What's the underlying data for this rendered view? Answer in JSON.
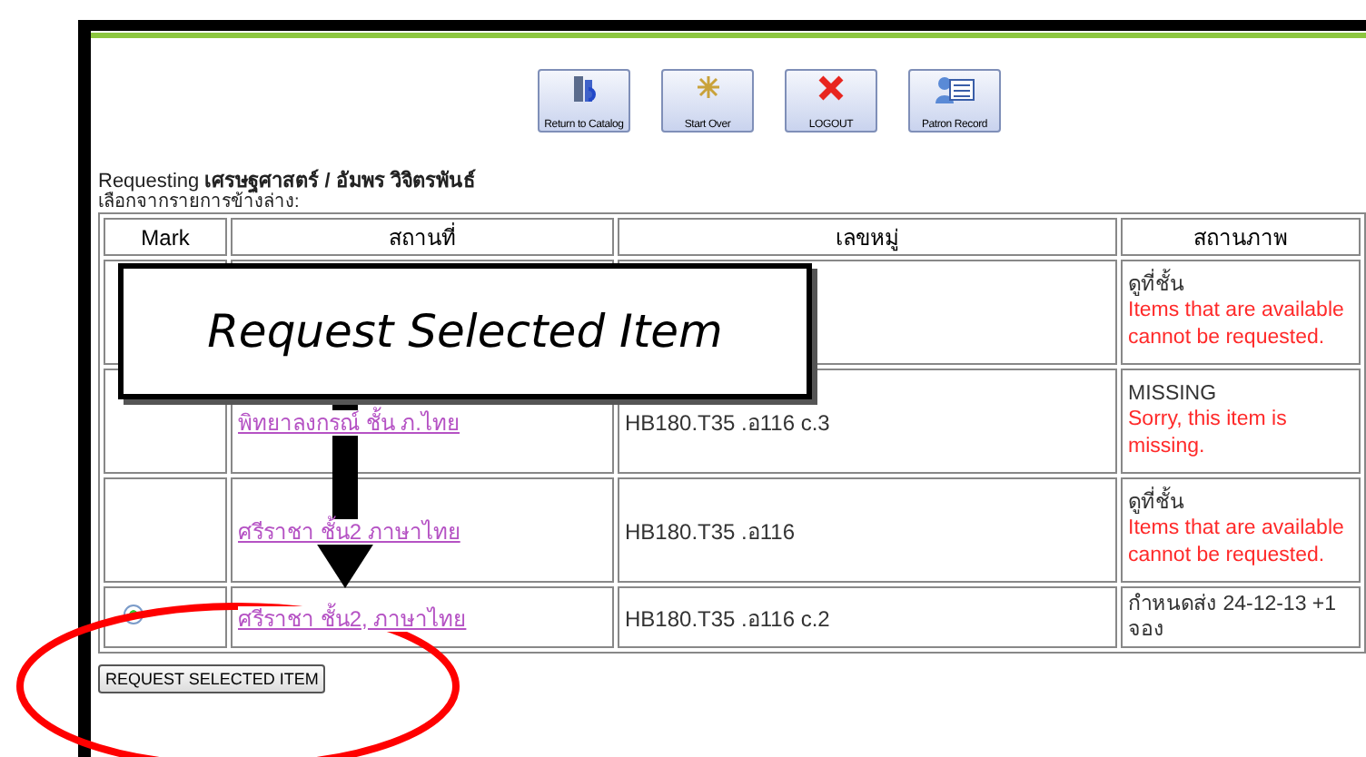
{
  "toolbar": [
    {
      "kind": "catalog",
      "label": "Return to Catalog"
    },
    {
      "kind": "restart",
      "label": "Start Over"
    },
    {
      "kind": "logout",
      "label": "LOGOUT"
    },
    {
      "kind": "patron",
      "label": "Patron Record"
    }
  ],
  "heading": "Requesting **เศรษฐศาสตร์ / อัมพร วิจิตรพันธ์**",
  "instruction": "เลือกจากรายการข้างล่าง:",
  "table": {
    "columns": [
      "Mark",
      "สถานที่",
      "เลขหมู่",
      "สถานภาพ"
    ],
    "rows": [
      {
        "kind": "plain",
        "selected": false,
        "status": "ดูที่ชั้น",
        "message": "Items that are available cannot be requested."
      },
      {
        "kind": "plain",
        "selected": false,
        "location": "พิทยาลงกรณ์ ชั้น ภ.ไทย",
        "call_number": "HB180.T35 .อ116 c.3",
        "status": "MISSING",
        "message": "Sorry, this item is missing."
      },
      {
        "kind": "plain",
        "selected": false,
        "location": "ศรีราชา ชั้น2 ภาษาไทย",
        "call_number": "HB180.T35 .อ116",
        "status": "ดูที่ชั้น",
        "message": "Items that are available cannot be requested."
      },
      {
        "kind": "radio",
        "selected": true,
        "location": "ศรีราชา ชั้น2, ภาษาไทย",
        "call_number": "HB180.T35 .อ116 c.2",
        "status": "กำหนดส่ง 24-12-13 +1 จอง"
      }
    ]
  },
  "submit": "REQUEST SELECTED ITEM",
  "annotation": {
    "label": "Request Selected Item"
  }
}
